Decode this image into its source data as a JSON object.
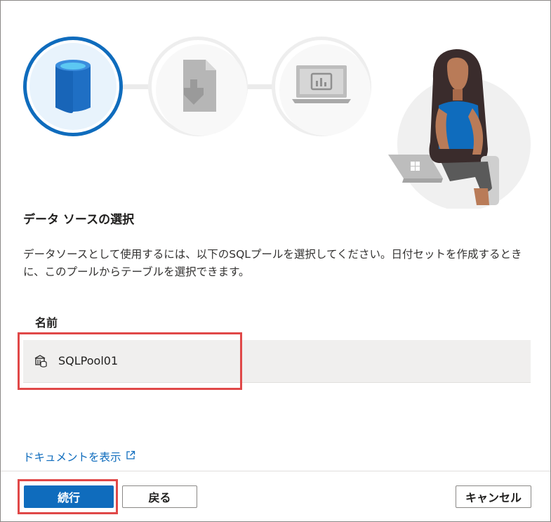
{
  "wizard": {
    "steps": [
      {
        "name": "select-data-source",
        "icon": "database-icon",
        "state": "active"
      },
      {
        "name": "import",
        "icon": "document-download-icon",
        "state": "inactive"
      },
      {
        "name": "report",
        "icon": "laptop-chart-icon",
        "state": "inactive"
      }
    ],
    "illustration": "person-with-laptop"
  },
  "content": {
    "title": "データ ソースの選択",
    "description": "データソースとして使用するには、以下のSQLプールを選択してください。日付セットを作成するときに、このプールからテーブルを選択できます。",
    "table": {
      "column_header": "名前",
      "rows": [
        {
          "label": "SQLPool01",
          "icon": "sql-pool-icon",
          "selected": true
        }
      ]
    },
    "doc_link": {
      "label": "ドキュメントを表示",
      "icon": "external-link-icon"
    }
  },
  "footer": {
    "continue_label": "続行",
    "back_label": "戻る",
    "cancel_label": "キャンセル"
  },
  "colors": {
    "accent": "#0f6cbd",
    "highlight": "#e04848",
    "row_selected": "#f0efee"
  }
}
